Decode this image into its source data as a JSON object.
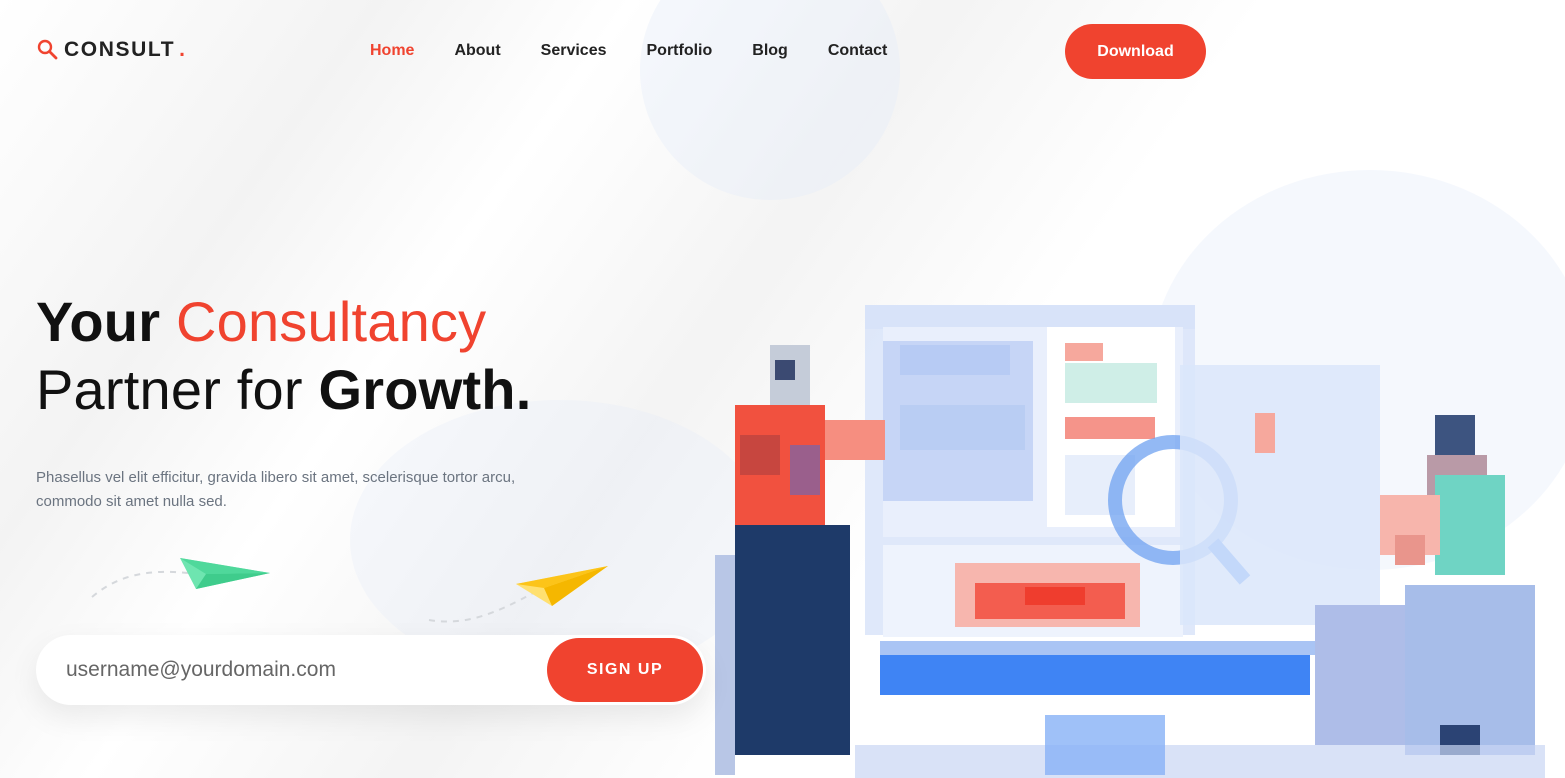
{
  "brand": {
    "name": "CONSULT",
    "dot": ".",
    "accent_color": "#f0432f"
  },
  "nav": {
    "items": [
      {
        "label": "Home",
        "active": true
      },
      {
        "label": "About",
        "active": false
      },
      {
        "label": "Services",
        "active": false
      },
      {
        "label": "Portfolio",
        "active": false
      },
      {
        "label": "Blog",
        "active": false
      },
      {
        "label": "Contact",
        "active": false
      }
    ],
    "download_label": "Download"
  },
  "hero": {
    "title_line1_a": "Your",
    "title_line1_b": "Consultancy",
    "title_line2_a": "Partner for",
    "title_line2_b": "Growth.",
    "description": "Phasellus vel elit efficitur, gravida libero sit amet, scelerisque tortor arcu, commodo sit amet nulla sed."
  },
  "signup": {
    "placeholder": "username@yourdomain.com",
    "button_label": "SIGN UP"
  },
  "icons": {
    "logo": "magnifier-icon",
    "plane_green": "paper-plane-icon",
    "plane_yellow": "paper-plane-icon"
  }
}
